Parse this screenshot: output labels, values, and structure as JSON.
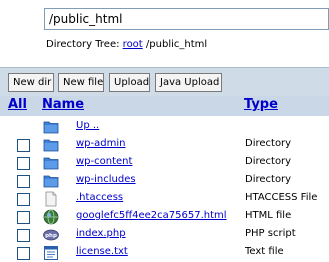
{
  "path_input": {
    "value": "/public_html"
  },
  "directory_tree": {
    "label": "Directory Tree:",
    "root_link": "root",
    "rest": "/public_html"
  },
  "toolbar": {
    "new_dir": "New dir",
    "new_file": "New file",
    "upload": "Upload",
    "java_upload": "Java Upload"
  },
  "headers": {
    "all": "All",
    "name": "Name",
    "type": "Type"
  },
  "files": [
    {
      "name": "Up ..",
      "type": "",
      "icon": "folder-icon"
    },
    {
      "name": "wp-admin",
      "type": "Directory",
      "icon": "folder-icon"
    },
    {
      "name": "wp-content",
      "type": "Directory",
      "icon": "folder-icon"
    },
    {
      "name": "wp-includes",
      "type": "Directory",
      "icon": "folder-icon"
    },
    {
      "name": ".htaccess",
      "type": "HTACCESS File",
      "icon": "blank-file-icon"
    },
    {
      "name": "googlefc5ff4ee2ca75657.html",
      "type": "HTML file",
      "icon": "globe-icon"
    },
    {
      "name": "index.php",
      "type": "PHP script",
      "icon": "php-icon"
    },
    {
      "name": "license.txt",
      "type": "Text file",
      "icon": "text-file-icon"
    }
  ]
}
